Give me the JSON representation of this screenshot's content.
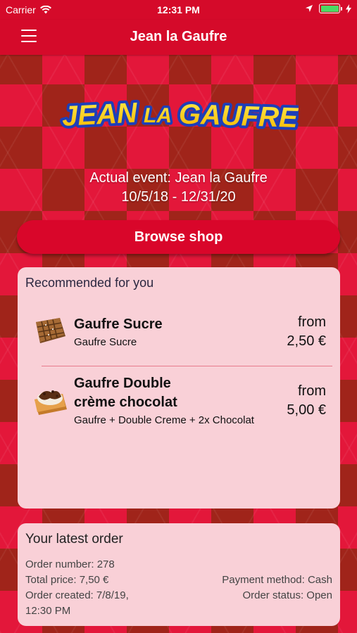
{
  "status_bar": {
    "carrier": "Carrier",
    "time": "12:31 PM",
    "icons": [
      "wifi-icon",
      "location-arrow-icon",
      "battery-icon",
      "charging-bolt-icon"
    ],
    "battery_color": "#4cd964"
  },
  "nav": {
    "title": "Jean la Gaufre",
    "menu_icon": "hamburger-menu-icon"
  },
  "logo": {
    "text": "JEAN LA GAUFRE"
  },
  "event": {
    "line1": "Actual event: Jean la Gaufre",
    "line2": "10/5/18 - 12/31/20"
  },
  "browse_button": {
    "label": "Browse shop"
  },
  "recommended": {
    "title": "Recommended for you",
    "items": [
      {
        "name": "Gaufre Sucre",
        "description": "Gaufre Sucre",
        "price_prefix": "from",
        "price": "2,50 €",
        "image": "waffle-sugar-image"
      },
      {
        "name": "Gaufre Double crème chocolat",
        "description": "Gaufre + Double Creme + 2x Chocolat",
        "price_prefix": "from",
        "price": "5,00 €",
        "image": "waffle-chocolate-image"
      }
    ]
  },
  "latest_order": {
    "title": "Your latest order",
    "order_number": "Order number: 278",
    "total_price": "Total price: 7,50 €",
    "order_created": "Order created: 7/8/19,",
    "order_created_time": "12:30 PM",
    "payment_method": "Payment method: Cash",
    "order_status": "Order status: Open"
  },
  "colors": {
    "primary_red": "#d50a2a",
    "background_red": "#e3173a",
    "background_dark": "#a0241a",
    "card_pink": "#f9d0d7"
  }
}
